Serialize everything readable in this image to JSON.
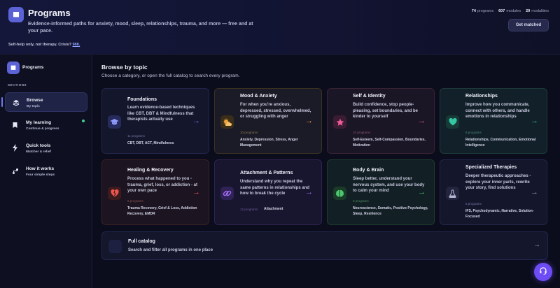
{
  "header": {
    "title": "Programs",
    "description": "Evidence-informed paths for anxiety, mood, sleep, relationships, trauma, and more — free and at your pace.",
    "crisis_text": "Self-help only, not therapy. Crisis?",
    "crisis_link": "988.",
    "stats": [
      {
        "value": "74",
        "label": "programs"
      },
      {
        "value": "607",
        "label": "modules"
      },
      {
        "value": "29",
        "label": "modalities"
      }
    ],
    "cta_label": "Get matched",
    "logo_icon": "book-icon"
  },
  "sidebar": {
    "title": "Programs",
    "section_label": "SECTIONS",
    "items": [
      {
        "label": "Browse",
        "sub": "By topic",
        "icon": "layers-icon"
      },
      {
        "label": "My learning",
        "sub": "Continue & progress",
        "icon": "bookmark-icon"
      },
      {
        "label": "Quick tools",
        "sub": "Matcher & relief",
        "icon": "lightning-icon"
      },
      {
        "label": "How it works",
        "sub": "Four simple steps",
        "icon": "steps-icon"
      }
    ]
  },
  "main": {
    "title": "Browse by topic",
    "subtitle": "Choose a category, or open the full catalog to search every program.",
    "cards": [
      {
        "title": "Foundations",
        "desc": "Learn evidence-based techniques like CBT, DBT & Mindfulness that therapists actually use",
        "count": "11 programs",
        "tags": "CBT, DBT, ACT, Mindfulness",
        "icon": "graduation-cap-icon",
        "accent": "#6f7cf5"
      },
      {
        "title": "Mood & Anxiety",
        "desc": "For when you're anxious, depressed, stressed, overwhelmed, or struggling with anger",
        "count": "10 programs",
        "tags": "Anxiety, Depression, Stress, Anger Management",
        "icon": "sun-cloud-icon",
        "accent": "#f3a33a"
      },
      {
        "title": "Self & Identity",
        "desc": "Build confidence, stop people-pleasing, set boundaries, and be kinder to yourself",
        "count": "10 programs",
        "tags": "Self-Esteem, Self-Compassion, Boundaries, Motivation",
        "icon": "star-icon",
        "accent": "#ef5a9b"
      },
      {
        "title": "Relationships",
        "desc": "Improve how you communicate, connect with others, and handle emotions in relationships",
        "count": "8 programs",
        "tags": "Relationships, Communication, Emotional Intelligence",
        "icon": "heart-icon",
        "accent": "#35c7a4"
      },
      {
        "title": "Healing & Recovery",
        "desc": "Process what happened to you - trauma, grief, loss, or addiction - at your own pace",
        "count": "9 programs",
        "tags": "Trauma Recovery, Grief & Loss, Addiction Recovery, EMDR",
        "icon": "broken-heart-icon",
        "accent": "#f0554d"
      },
      {
        "title": "Attachment & Patterns",
        "desc": "Understand why you repeat the same patterns in relationships and how to break the cycle",
        "count": "12 programs",
        "tags": "Attachment",
        "icon": "link-icon",
        "accent": "#a46cf5"
      },
      {
        "title": "Body & Brain",
        "desc": "Sleep better, understand your nervous system, and use your body to calm your mind",
        "count": "9 programs",
        "tags": "Neuroscience, Somatic, Positive Psychology, Sleep, Resilience",
        "icon": "brain-icon",
        "accent": "#4cc96f"
      },
      {
        "title": "Specialized Therapies",
        "desc": "Deeper therapeutic approaches - explore your inner parts, rewrite your story, find solutions",
        "count": "5 programs",
        "tags": "IFS, Psychodynamic, Narrative, Solution-Focused",
        "icon": "flask-icon",
        "accent": "#9a9db8"
      }
    ],
    "full_catalog": {
      "title": "Full catalog",
      "subtitle": "Search and filter all programs in one place"
    }
  },
  "support_icon": "headset-icon"
}
